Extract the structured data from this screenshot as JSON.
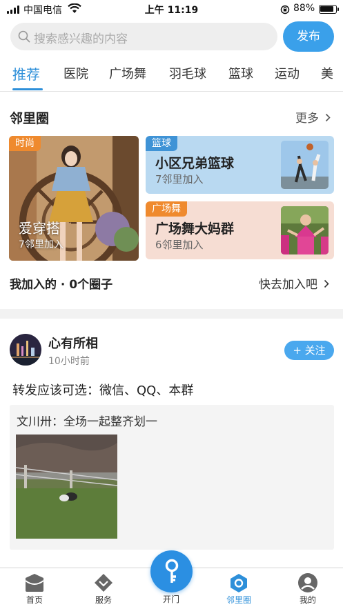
{
  "status_bar": {
    "carrier": "中国电信",
    "time": "上午 11:19",
    "battery": "88%"
  },
  "search": {
    "placeholder": "搜索感兴趣的内容",
    "publish_label": "发布"
  },
  "tabs": [
    "推荐",
    "医院",
    "广场舞",
    "羽毛球",
    "篮球",
    "运动",
    "美"
  ],
  "active_tab": 0,
  "circles": {
    "title": "邻里圈",
    "more_label": "更多",
    "cards": [
      {
        "tag": "时尚",
        "name": "爱穿搭",
        "count": "7邻里加入"
      },
      {
        "tag": "篮球",
        "name": "小区兄弟篮球",
        "count": "7邻里加入"
      },
      {
        "tag": "广场舞",
        "name": "广场舞大妈群",
        "count": "6邻里加入"
      }
    ],
    "joined_label": "我加入的 · 0个圈子",
    "join_link": "快去加入吧"
  },
  "post": {
    "author": "心有所相",
    "time": "10小时前",
    "follow_label": "+ 关注",
    "text": "转发应该可选：微信、QQ、本群",
    "quote": "文川卅：全场一起整齐划一"
  },
  "bottom_nav": {
    "items": [
      "首页",
      "服务",
      "开门",
      "邻里圈",
      "我的"
    ],
    "active": "邻里圈"
  },
  "colors": {
    "accent": "#2d8fd9",
    "publish": "#3aa0ea",
    "tag_orange": "#ef8a2e",
    "tag_blue": "#3f93d6"
  }
}
